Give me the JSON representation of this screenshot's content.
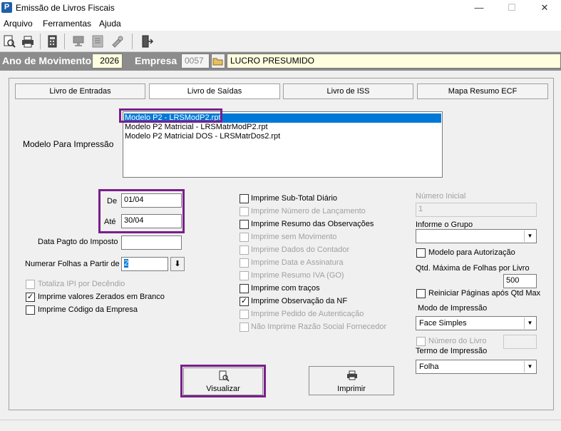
{
  "window": {
    "app_icon": "P",
    "title": "Emissão de Livros Fiscais",
    "minimize": "—",
    "maximize": "☐",
    "close": "✕"
  },
  "menu": [
    "Arquivo",
    "Ferramentas",
    "Ajuda"
  ],
  "toolbar_icons": [
    "preview-icon",
    "print-icon",
    "calculator-icon",
    "computer-icon",
    "report-icon",
    "tools-icon",
    "exit-door-icon"
  ],
  "header": {
    "ano_label": "Ano de Movimento",
    "ano_value": "2026",
    "empresa_label": "Empresa",
    "empresa_code": "0057",
    "empresa_name": "LUCRO PRESUMIDO"
  },
  "tabs": [
    "Livro de Entradas",
    "Livro de Saídas",
    "Livro de ISS",
    "Mapa Resumo ECF"
  ],
  "modelo": {
    "label": "Modelo Para Impressão",
    "items": [
      "Modelo P2 - LRSModP2.rpt",
      "Modelo P2 Matricial - LRSMatrModP2.rpt",
      "Modelo P2 Matricial DOS - LRSMatrDos2.rpt"
    ]
  },
  "periodo": {
    "de_label": "De",
    "de_value": "01/04",
    "ate_label": "Até",
    "ate_value": "30/04"
  },
  "data_pagto_label": "Data Pagto do Imposto",
  "data_pagto_value": "",
  "numerar_label": "Numerar Folhas a Partir de",
  "numerar_value": "2",
  "left_checks": [
    {
      "label": "Totaliza IPI por Decêndio",
      "checked": false,
      "enabled": false
    },
    {
      "label": "Imprime valores Zerados em Branco",
      "checked": true,
      "enabled": true
    },
    {
      "label": "Imprime Código da Empresa",
      "checked": false,
      "enabled": true
    }
  ],
  "mid_checks": [
    {
      "label": "Imprime Sub-Total Diário",
      "checked": false,
      "enabled": true
    },
    {
      "label": "Imprime Número de Lançamento",
      "checked": false,
      "enabled": false
    },
    {
      "label": "Imprime Resumo das Observações",
      "checked": false,
      "enabled": true
    },
    {
      "label": "Imprime sem Movimento",
      "checked": false,
      "enabled": false
    },
    {
      "label": "Imprime Dados do Contador",
      "checked": false,
      "enabled": false
    },
    {
      "label": "Imprime Data e Assinatura",
      "checked": false,
      "enabled": false
    },
    {
      "label": "Imprime Resumo IVA (GO)",
      "checked": false,
      "enabled": false
    },
    {
      "label": "Imprime com traços",
      "checked": false,
      "enabled": true
    },
    {
      "label": "Imprime Observação da NF",
      "checked": true,
      "enabled": true
    },
    {
      "label": "Imprime Pedido de Autenticação",
      "checked": false,
      "enabled": false
    },
    {
      "label": "Não Imprime Razão Social Fornecedor",
      "checked": false,
      "enabled": false
    }
  ],
  "right": {
    "numero_inicial_label": "Número Inicial",
    "numero_inicial_value": "1",
    "grupo_label": "Informe o Grupo",
    "grupo_value": "",
    "modelo_autorizacao_label": "Modelo para Autorização",
    "qtd_max_label": "Qtd. Máxima de Folhas por Livro",
    "qtd_max_value": "500",
    "reiniciar_label": "Reiniciar Páginas após Qtd Max",
    "modo_label": "Modo de Impressão",
    "modo_value": "Face Simples",
    "numero_livro_label": "Número do Livro",
    "numero_livro_value": "",
    "termo_label": "Termo de Impressão",
    "termo_value": "Folha"
  },
  "buttons": {
    "visualizar": "Visualizar",
    "imprimir": "Imprimir"
  },
  "colors": {
    "highlight": "#7a1e8c",
    "selection": "#0078d7",
    "header_bg": "#8c8c8c",
    "field_yellow": "#ffffe0"
  }
}
